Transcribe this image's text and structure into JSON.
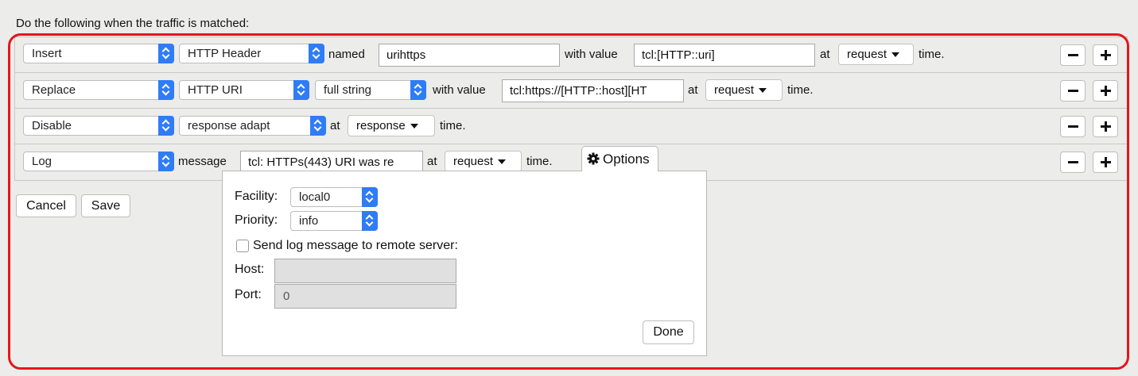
{
  "heading": "Do the following when the traffic is matched:",
  "rows": [
    {
      "action": "Insert",
      "target": "HTTP Header",
      "named_label": "named",
      "name_value": "urihttps",
      "with_value_label": "with value",
      "value": "tcl:[HTTP::uri]",
      "at_label": "at",
      "event": "request",
      "time_label": "time."
    },
    {
      "action": "Replace",
      "target": "HTTP URI",
      "mode": "full string",
      "with_value_label": "with value",
      "value": "tcl:https://[HTTP::host][HT",
      "at_label": "at",
      "event": "request",
      "time_label": "time."
    },
    {
      "action": "Disable",
      "target": "response adapt",
      "at_label": "at",
      "event": "response",
      "time_label": "time."
    },
    {
      "action": "Log",
      "message_label": "message",
      "value": "tcl: HTTPs(443) URI was re",
      "at_label": "at",
      "event": "request",
      "time_label": "time."
    }
  ],
  "buttons": {
    "cancel": "Cancel",
    "save": "Save",
    "done": "Done"
  },
  "options": {
    "tab_label": "Options",
    "facility_label": "Facility:",
    "facility_value": "local0",
    "priority_label": "Priority:",
    "priority_value": "info",
    "remote_label": "Send log message to remote server:",
    "remote_checked": false,
    "host_label": "Host:",
    "host_value": "",
    "port_label": "Port:",
    "port_value": "0"
  },
  "colors": {
    "highlight": "#e8141c",
    "select_arrow": "#2f7cf6",
    "background": "#ececea"
  }
}
